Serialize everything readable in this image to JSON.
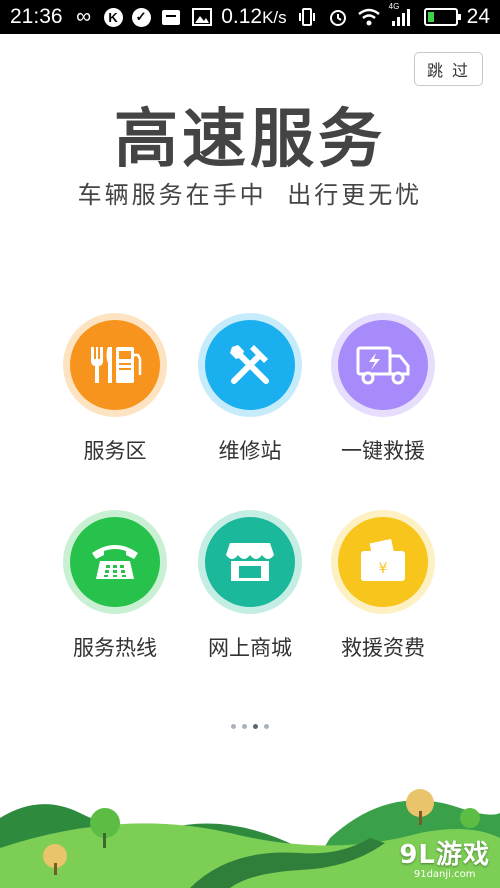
{
  "status_bar": {
    "time": "21:36",
    "speed": "0.12",
    "speed_unit": "K/s",
    "battery_level": "24",
    "network": "4G"
  },
  "skip_label": "跳 过",
  "title": "高速服务",
  "subtitle": "车辆服务在手中  出行更无忧",
  "services": [
    {
      "label": "服务区",
      "icon": "fuel-restaurant-icon",
      "color": "#f7941d",
      "ring": "#fde3c2"
    },
    {
      "label": "维修站",
      "icon": "repair-tools-icon",
      "color": "#1ab0ef",
      "ring": "#c6ecfb"
    },
    {
      "label": "一键救援",
      "icon": "tow-truck-icon",
      "color": "#a78bfa",
      "ring": "#e7defd"
    },
    {
      "label": "服务热线",
      "icon": "telephone-icon",
      "color": "#26c24b",
      "ring": "#c9f0d3"
    },
    {
      "label": "网上商城",
      "icon": "shop-icon",
      "color": "#1cb89b",
      "ring": "#c4ede4"
    },
    {
      "label": "救援资费",
      "icon": "wallet-yuan-icon",
      "color": "#f7c51b",
      "ring": "#fdf0c3"
    }
  ],
  "pager": {
    "count": 4,
    "active_index": 2
  },
  "watermark": {
    "main": "9L游戏",
    "sub": "91danji.com"
  }
}
